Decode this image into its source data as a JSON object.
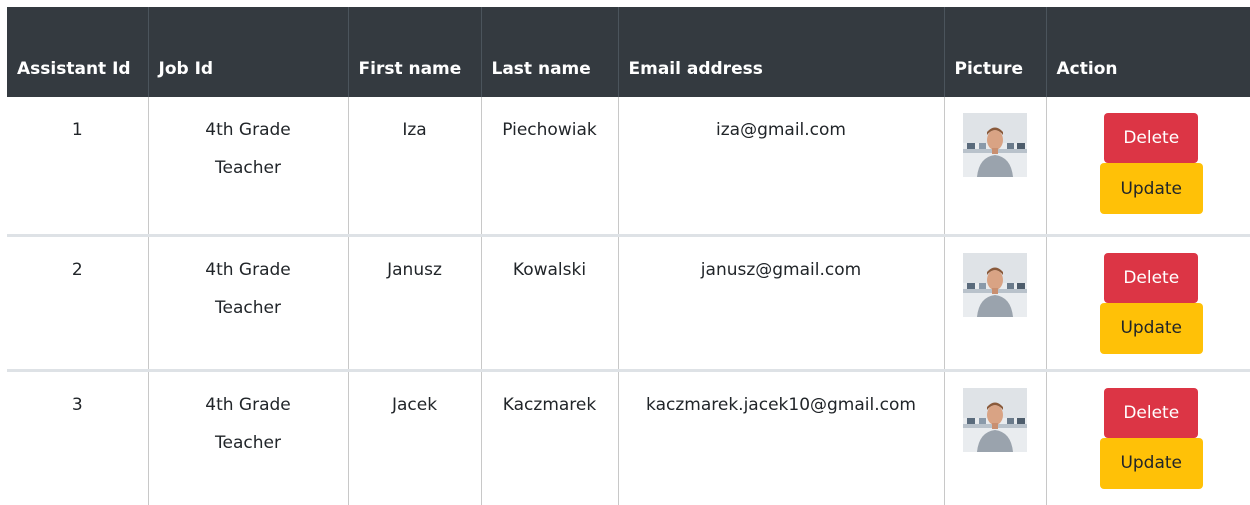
{
  "table": {
    "headers": {
      "assistant_id": "Assistant Id",
      "job_id": "Job Id",
      "first_name": "First name",
      "last_name": "Last name",
      "email": "Email address",
      "picture": "Picture",
      "action": "Action"
    },
    "rows": [
      {
        "assistant_id": "1",
        "job_id": "4th Grade Teacher",
        "first_name": "Iza",
        "last_name": "Piechowiak",
        "email": "iza@gmail.com",
        "picture_icon": "person-photo",
        "delete_label": "Delete",
        "update_label": "Update"
      },
      {
        "assistant_id": "2",
        "job_id": "4th Grade Teacher",
        "first_name": "Janusz",
        "last_name": "Kowalski",
        "email": "janusz@gmail.com",
        "picture_icon": "person-photo",
        "delete_label": "Delete",
        "update_label": "Update"
      },
      {
        "assistant_id": "3",
        "job_id": "4th Grade Teacher",
        "first_name": "Jacek",
        "last_name": "Kaczmarek",
        "email": "kaczmarek.jacek10@gmail.com",
        "picture_icon": "person-photo",
        "delete_label": "Delete",
        "update_label": "Update"
      }
    ]
  },
  "colors": {
    "header_bg": "#343a40",
    "delete": "#dc3545",
    "update": "#ffc107"
  }
}
